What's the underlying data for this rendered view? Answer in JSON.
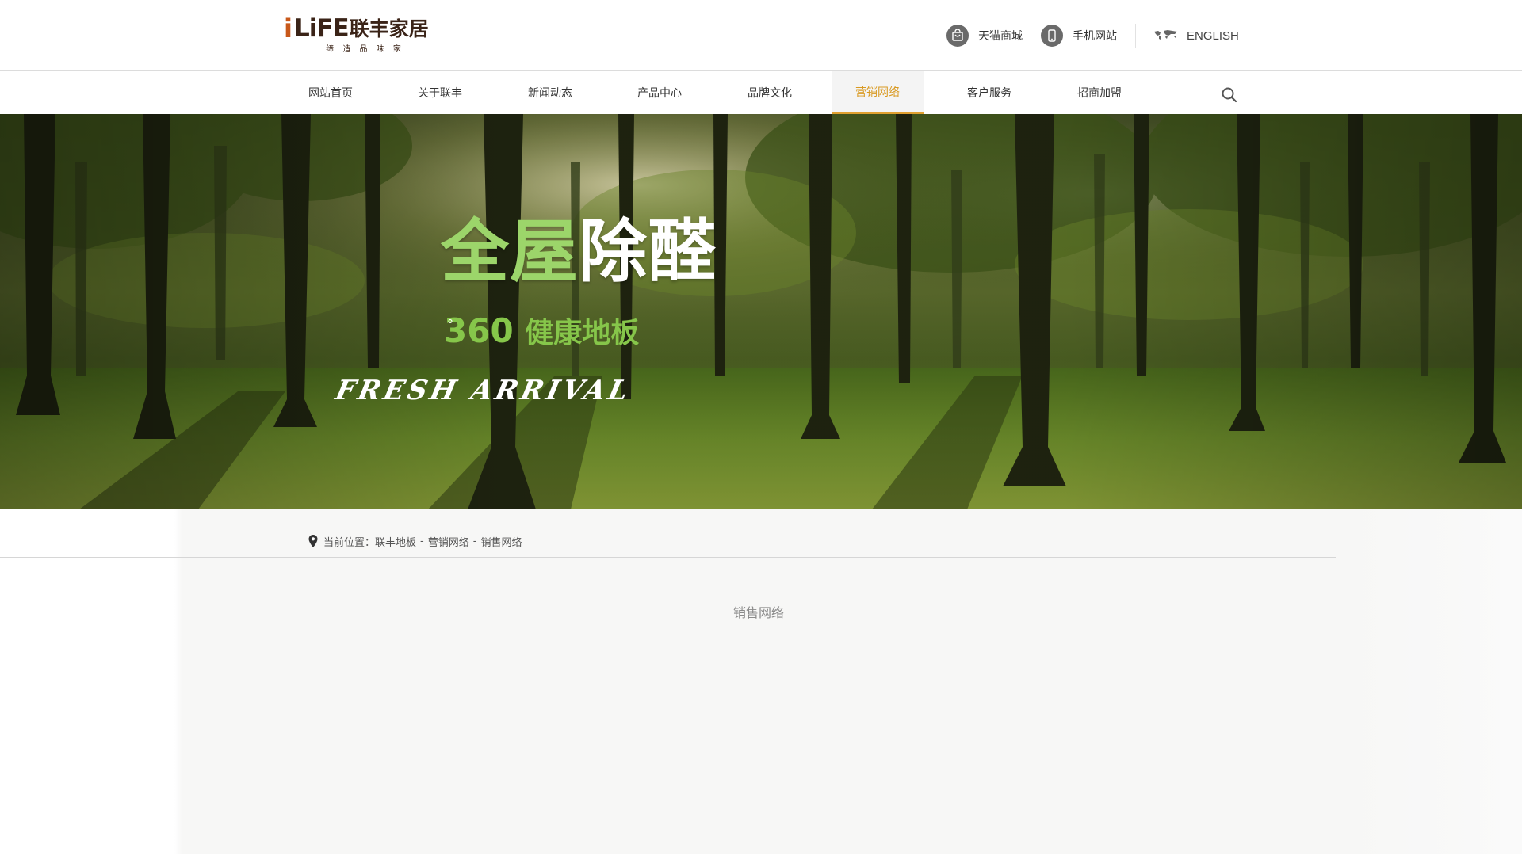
{
  "logo": {
    "prefix": "i",
    "brand": "LiFE",
    "brand_cn": "联丰家居",
    "tagline": "缔 造 品 味 家"
  },
  "header_links": {
    "tmall": "天猫商城",
    "mobile": "手机网站",
    "english": "ENGLISH"
  },
  "nav": {
    "items": [
      "网站首页",
      "关于联丰",
      "新闻动态",
      "产品中心",
      "品牌文化",
      "营销网络",
      "客户服务",
      "招商加盟"
    ],
    "active": "营销网络"
  },
  "banner": {
    "title_part1": "全屋",
    "title_part2": "除醛",
    "degree": "°",
    "subtitle_num": "360",
    "subtitle_text": "健康地板",
    "slogan": "FRESH ARRIVAL"
  },
  "breadcrumb": {
    "label": "当前位置：",
    "items": [
      "联丰地板",
      "营销网络",
      "销售网络"
    ],
    "separator": "-"
  },
  "page": {
    "section_title": "销售网络"
  },
  "colors": {
    "accent": "#d99a22",
    "logo_orange": "#c8581a",
    "logo_brown": "#3a2317",
    "banner_green": "#9cd56a"
  },
  "icons": {
    "tmall": "tmall-bag-icon",
    "mobile": "mobile-phone-icon",
    "english": "world-map-icon",
    "search": "search-icon",
    "location": "map-pin-icon"
  }
}
